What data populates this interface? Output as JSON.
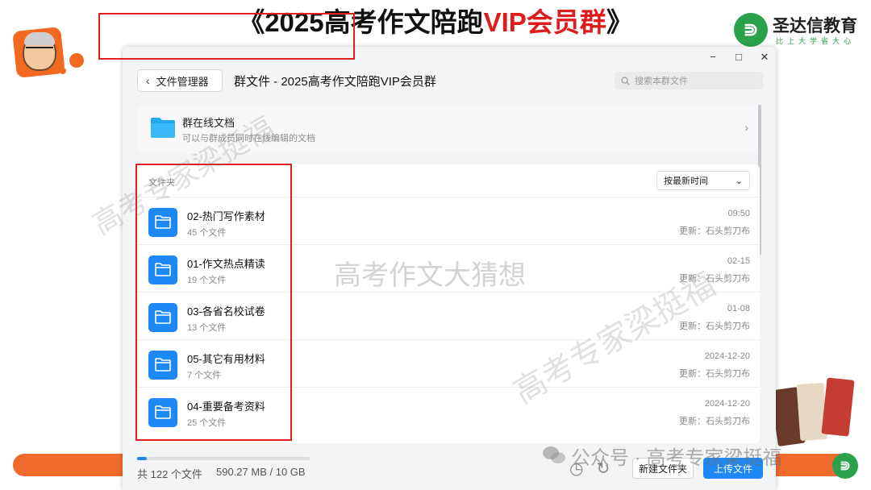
{
  "headline": {
    "prefix": "《2025高考作文陪跑",
    "highlight": "VIP会员群",
    "suffix": "》",
    "highlight_color": "#e01b1b"
  },
  "brand": {
    "name": "圣达信教育",
    "tagline": "比上大学省大心",
    "logo_glyph": "⋑",
    "color": "#2aa14a"
  },
  "window": {
    "controls": {
      "minimize": "−",
      "maximize": "□",
      "close": "✕"
    },
    "back_label": "文件管理器",
    "title": "群文件 - 2025高考作文陪跑VIP会员群",
    "search_placeholder": "搜索本群文件",
    "online_docs": {
      "title": "群在线文档",
      "subtitle": "可以与群成员同时在线编辑的文档"
    },
    "folder_section_label": "文件夹",
    "sort_label": "按最新时间",
    "folders": [
      {
        "name": "02-热门写作素材",
        "count": "45 个文件",
        "date": "09:50",
        "updater": "更新：石头剪刀布"
      },
      {
        "name": "01-作文热点精读",
        "count": "19 个文件",
        "date": "02-15",
        "updater": "更新：石头剪刀布"
      },
      {
        "name": "03-各省名校试卷",
        "count": "13 个文件",
        "date": "01-08",
        "updater": "更新：石头剪刀布"
      },
      {
        "name": "05-其它有用材料",
        "count": "7 个文件",
        "date": "2024-12-20",
        "updater": "更新：石头剪刀布"
      },
      {
        "name": "04-重要备考资料",
        "count": "25 个文件",
        "date": "2024-12-20",
        "updater": "更新：石头剪刀布"
      }
    ],
    "footer": {
      "total_files": "共 122 个文件",
      "storage": "590.27 MB / 10 GB",
      "storage_used_fraction": 0.058,
      "new_folder_label": "新建文件夹",
      "upload_label": "上传文件"
    },
    "accent": "#1e88f5"
  },
  "watermarks": {
    "diagonal_left": "高考专家梁挺福",
    "center": "高考作文大猜想",
    "diagonal_right": "高考专家梁挺福",
    "wechat": "公众号 · 高考专家梁挺福"
  }
}
